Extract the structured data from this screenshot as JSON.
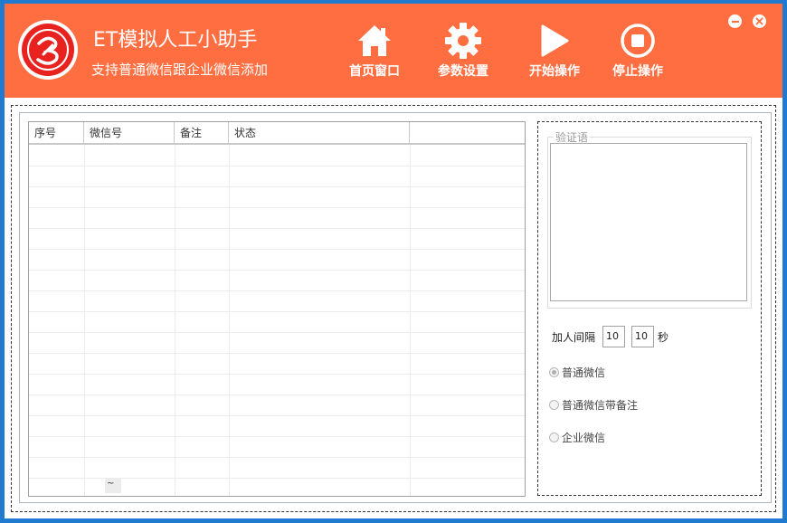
{
  "app": {
    "title": "ET模拟人工小助手",
    "subtitle": "支持普通微信跟企业微信添加"
  },
  "toolbar": {
    "home_label": "首页窗口",
    "settings_label": "参数设置",
    "start_label": "开始操作",
    "stop_label": "停止操作"
  },
  "window_controls": {
    "minimize": "minimize-icon",
    "close": "close-icon"
  },
  "table": {
    "columns": [
      "序号",
      "微信号",
      "备注",
      "状态",
      ""
    ],
    "rows": [],
    "cell_marker": "~"
  },
  "panel": {
    "group_title": "验证语",
    "message_value": "",
    "interval_label": "加人间隔",
    "interval_min": "10",
    "interval_max": "10",
    "interval_unit": "秒",
    "modes": [
      {
        "label": "普通微信",
        "checked": true
      },
      {
        "label": "普通微信带备注",
        "checked": false
      },
      {
        "label": "企业微信",
        "checked": false
      }
    ]
  },
  "colors": {
    "header_bg": "#ff6e40",
    "window_border": "#1f7ad0",
    "logo_red": "#e8221e"
  }
}
